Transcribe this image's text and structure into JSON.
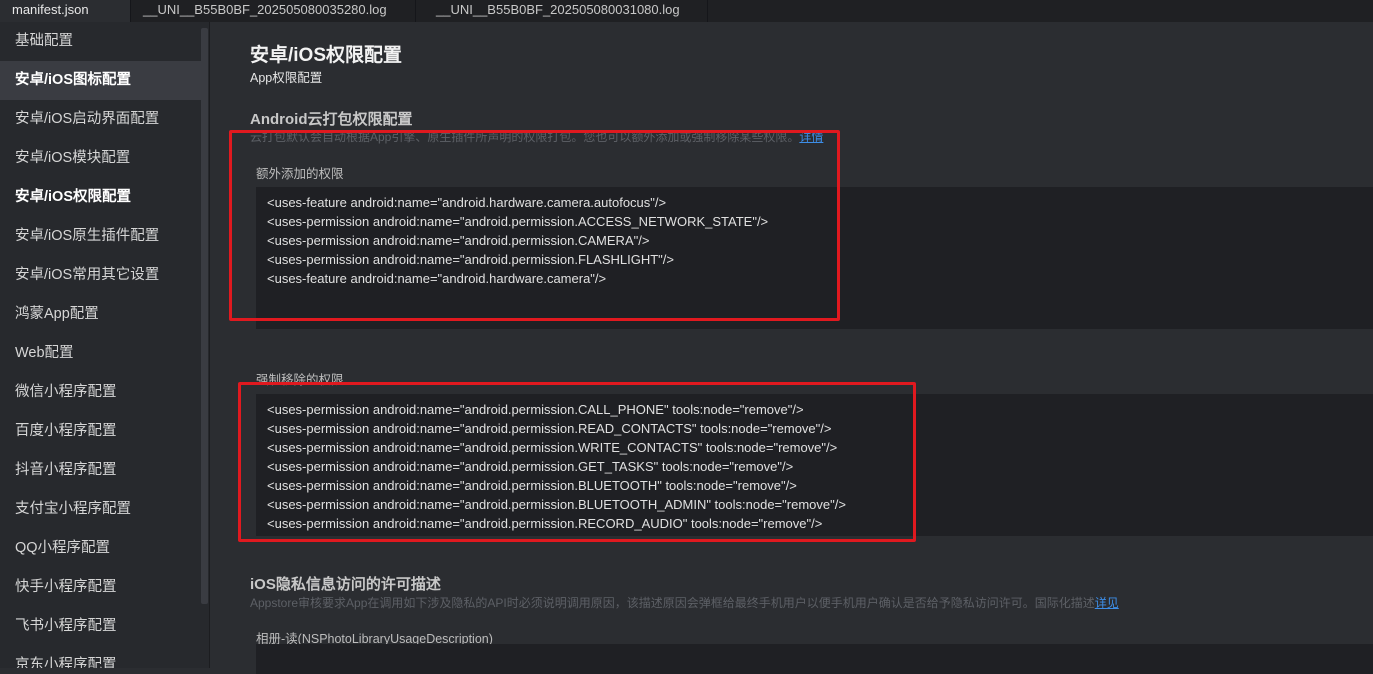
{
  "tabs": [
    {
      "label": "manifest.json",
      "active": true
    },
    {
      "label": "__UNI__B55B0BF_202505080035280.log",
      "active": false
    },
    {
      "label": "__UNI__B55B0BF_202505080031080.log",
      "active": false
    }
  ],
  "sidebar": {
    "items": [
      {
        "label": "基础配置"
      },
      {
        "label": "安卓/iOS图标配置"
      },
      {
        "label": "安卓/iOS启动界面配置"
      },
      {
        "label": "安卓/iOS模块配置"
      },
      {
        "label": "安卓/iOS权限配置"
      },
      {
        "label": "安卓/iOS原生插件配置"
      },
      {
        "label": "安卓/iOS常用其它设置"
      },
      {
        "label": "鸿蒙App配置"
      },
      {
        "label": "Web配置"
      },
      {
        "label": "微信小程序配置"
      },
      {
        "label": "百度小程序配置"
      },
      {
        "label": "抖音小程序配置"
      },
      {
        "label": "支付宝小程序配置"
      },
      {
        "label": "QQ小程序配置"
      },
      {
        "label": "快手小程序配置"
      },
      {
        "label": "飞书小程序配置"
      },
      {
        "label": "京东小程序配置"
      }
    ]
  },
  "page": {
    "title": "安卓/iOS权限配置",
    "subtitle": "App权限配置"
  },
  "android_section": {
    "title": "Android云打包权限配置",
    "desc": "云打包默认会自动根据App引擎、原生插件所声明的权限打包。您也可以额外添加或强制移除某些权限。",
    "desc_link": "详情"
  },
  "extra_permissions": {
    "label": "额外添加的权限",
    "lines": [
      "<uses-feature android:name=\"android.hardware.camera.autofocus\"/>",
      "<uses-permission android:name=\"android.permission.ACCESS_NETWORK_STATE\"/>",
      "<uses-permission android:name=\"android.permission.CAMERA\"/>",
      "<uses-permission android:name=\"android.permission.FLASHLIGHT\"/>",
      "<uses-feature android:name=\"android.hardware.camera\"/>"
    ]
  },
  "removed_permissions": {
    "label": "强制移除的权限",
    "lines": [
      "<uses-permission android:name=\"android.permission.CALL_PHONE\" tools:node=\"remove\"/>",
      "<uses-permission android:name=\"android.permission.READ_CONTACTS\" tools:node=\"remove\"/>",
      "<uses-permission android:name=\"android.permission.WRITE_CONTACTS\" tools:node=\"remove\"/>",
      "<uses-permission android:name=\"android.permission.GET_TASKS\" tools:node=\"remove\"/>",
      "<uses-permission android:name=\"android.permission.BLUETOOTH\" tools:node=\"remove\"/>",
      "<uses-permission android:name=\"android.permission.BLUETOOTH_ADMIN\" tools:node=\"remove\"/>",
      "<uses-permission android:name=\"android.permission.RECORD_AUDIO\" tools:node=\"remove\"/>"
    ]
  },
  "ios_section": {
    "title": "iOS隐私信息访问的许可描述",
    "desc": "Appstore审核要求App在调用如下涉及隐私的API时必须说明调用原因，该描述原因会弹框给最终手机用户以便手机用户确认是否给予隐私访问许可。国际化描述",
    "desc_link": "详见"
  },
  "photo_library": {
    "label": "相册-读(NSPhotoLibraryUsageDescription)"
  },
  "colors": {
    "highlight_border": "#e0191f",
    "link": "#3d8ee8",
    "background": "#2b2d31"
  }
}
